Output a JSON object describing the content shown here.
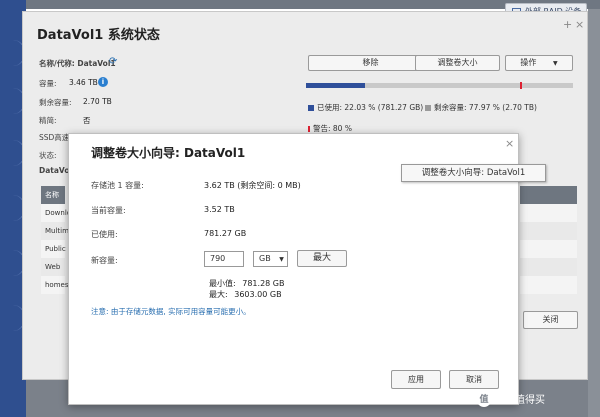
{
  "backdrop": {
    "external_tab_label": "外部 RAID 设备"
  },
  "status_window": {
    "title": "DataVol1  系统状态",
    "close_glyph": "×",
    "add_glyph": "+",
    "name_label": "名称/代称: DataVol1",
    "capacity_label": "容量:",
    "capacity_value": "3.46 TB",
    "free_label": "剩余容量:",
    "free_value": "2.70 TB",
    "thin_label": "精简:",
    "thin_value": "否",
    "ssd_label": "SSD高速",
    "state_label": "状态:",
    "volume_label": "DataVol1",
    "buttons": {
      "remove": "移除",
      "resize": "调整卷大小",
      "actions": "操作"
    },
    "usage": {
      "used_fraction": 0.2203,
      "warning_fraction": 0.8,
      "used_legend": "已使用: 22.03 % (781.27 GB)",
      "free_legend": "剩余容量: 77.97 % (2.70 TB)",
      "warning_legend": "警告: 80 %"
    },
    "table": {
      "header": "名称",
      "rows": [
        "Downlo",
        "Multim",
        "Public",
        "Web",
        "homes"
      ]
    },
    "close_button": "关闭"
  },
  "dialog": {
    "title": "调整卷大小向导:  DataVol1",
    "close_glyph": "×",
    "rows": [
      {
        "label": "存储池 1 容量:",
        "value": "3.62 TB (剩余空间: 0 MB)"
      },
      {
        "label": "当前容量:",
        "value": "3.52 TB"
      },
      {
        "label": "已使用:",
        "value": "781.27 GB"
      }
    ],
    "new_capacity_label": "新容量:",
    "new_capacity_value": "790",
    "unit": "GB",
    "max_button": "最大",
    "min_label": "最小值:",
    "min_value": "781.28 GB",
    "max_label": "最大:",
    "max_value": "3603.00 GB",
    "note": "注意: 由于存储元数据, 实际可用容量可能更小。",
    "apply_button": "应用",
    "cancel_button": "取消"
  },
  "tooltip": "调整卷大小向导:  DataVol1",
  "watermark": {
    "badge": "值",
    "text": "什么值得买"
  },
  "colors": {
    "accent_blue": "#2f4f9a",
    "warning_red": "#dd2233",
    "note_blue": "#2a6fb0",
    "free_gray": "#c9c9c9"
  }
}
